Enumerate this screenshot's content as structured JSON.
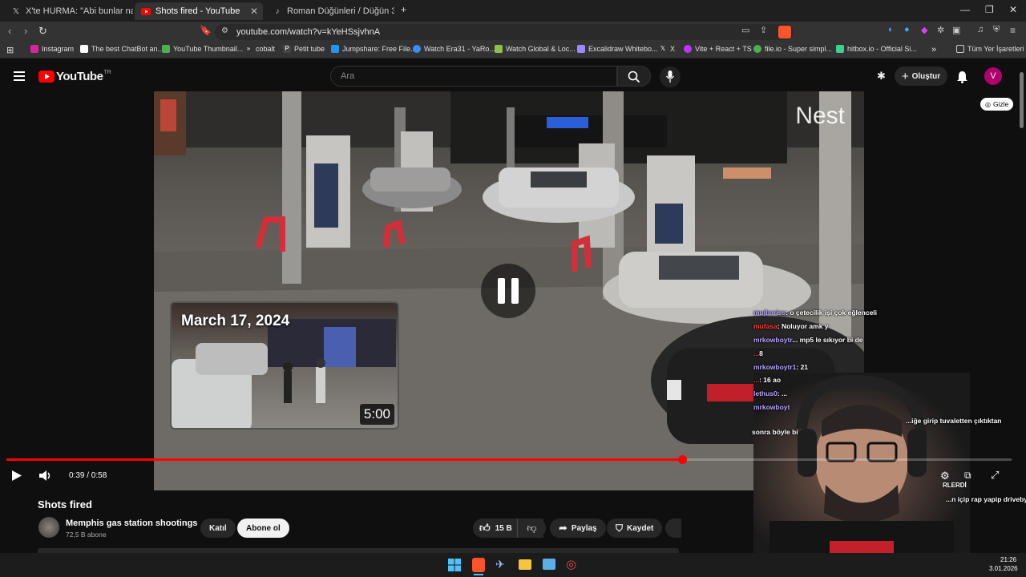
{
  "browser": {
    "tabs": [
      {
        "title": "X'te HURMA: \"Abi bunlar nasıl bir ka",
        "icon": "x-logo-icon"
      },
      {
        "title": "Shots fired - YouTube",
        "icon": "youtube-icon"
      },
      {
        "title": "Roman Düğünleri / Düğün 35 (@dug",
        "icon": "tiktok-icon"
      }
    ],
    "url": "youtube.com/watch?v=kYeHSsjvhnA",
    "bookmarks": [
      "Instagram",
      "The best ChatBot an...",
      "YouTube Thumbnail...",
      "cobalt",
      "Petit tube",
      "Jumpshare: Free File...",
      "Watch Era31 - YaRo...",
      "Watch Global & Loc...",
      "Excalidraw Whitebo...",
      "X",
      "Vite + React + TS",
      "file.io - Super simpl...",
      "hitbox.io - Official Si..."
    ],
    "all_bookmarks": "Tüm Yer İşaretleri"
  },
  "youtube": {
    "logo": "YouTube",
    "logo_region": "TR",
    "search_placeholder": "Ara",
    "create_label": "Oluştur",
    "avatar_letter": "V"
  },
  "player": {
    "watermark": "Nest",
    "hide_label": "Gizle",
    "inset_date": "March 17, 2024",
    "inset_duration": "5:00",
    "time": "0:39 / 0:58",
    "progress": 0.672,
    "overlay_text_1": "RLERDİ"
  },
  "video": {
    "title": "Shots fired",
    "channel": "Memphis gas station shootings",
    "subscribers": "72,5 B abone",
    "join_label": "Katıl",
    "subscribe_label": "Abone ol",
    "likes": "15 B",
    "share_label": "Paylaş",
    "save_label": "Kaydet"
  },
  "chat": [
    {
      "user": "mujbariss",
      "msg": ": o çetecilik işi çok eğlenceli"
    },
    {
      "user": "mufasa",
      "msg": ": Noluyor amk y"
    },
    {
      "user": "mrkowboytr",
      "msg": "... mp5 le sıkıyor bi de"
    },
    {
      "user": "...",
      "msg": "8"
    },
    {
      "user": "mrkowboytr1",
      "msg": ": 21"
    },
    {
      "user": "...",
      "msg": ": 16 ao"
    },
    {
      "user": "lethus0",
      "msg": ": ..."
    },
    {
      "user": "mrkowboyt",
      "msg": ""
    }
  ],
  "chat_side": [
    "...iğe girip tuvaletten çıktıktan",
    "sonra böyle bi",
    "...n içip rap yapip driveby"
  ],
  "taskbar": {
    "time": "21:26",
    "date": "3.01.2026"
  },
  "colors": {
    "youtube_red": "#ff0000",
    "subscribe_bg": "#f1f1f1",
    "header_bg": "#0f0f0f"
  }
}
